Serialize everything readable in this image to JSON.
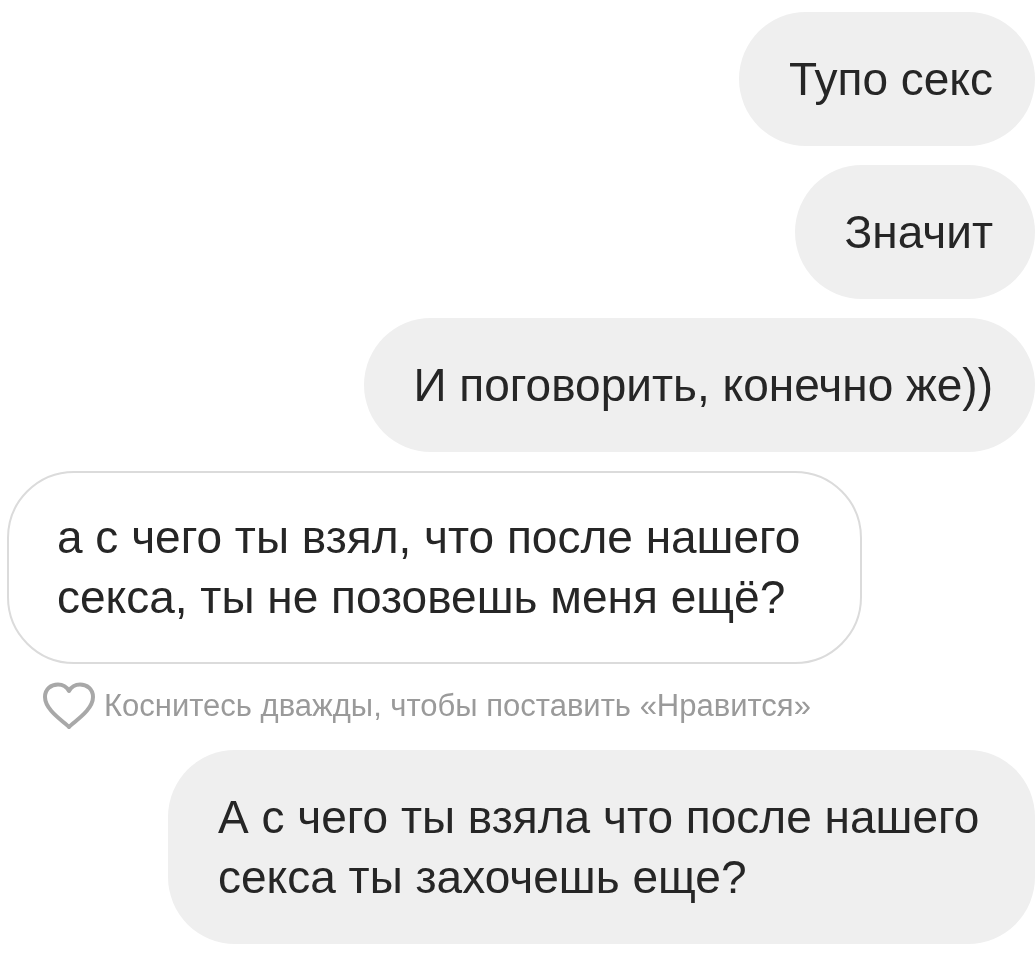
{
  "messages": [
    {
      "kind": "outgoing",
      "text": "Тупо секс"
    },
    {
      "kind": "outgoing",
      "text": "Значит"
    },
    {
      "kind": "outgoing",
      "text": "И поговорить, конечно же))"
    },
    {
      "kind": "incoming",
      "text": "а с чего ты взял, что после нашего секса, ты не позовешь меня ещё?",
      "hint": "Коснитесь дважды, чтобы поставить «Нравится»"
    },
    {
      "kind": "outgoing",
      "text": "А с чего ты взяла что после нашего секса ты захочешь еще?"
    }
  ]
}
